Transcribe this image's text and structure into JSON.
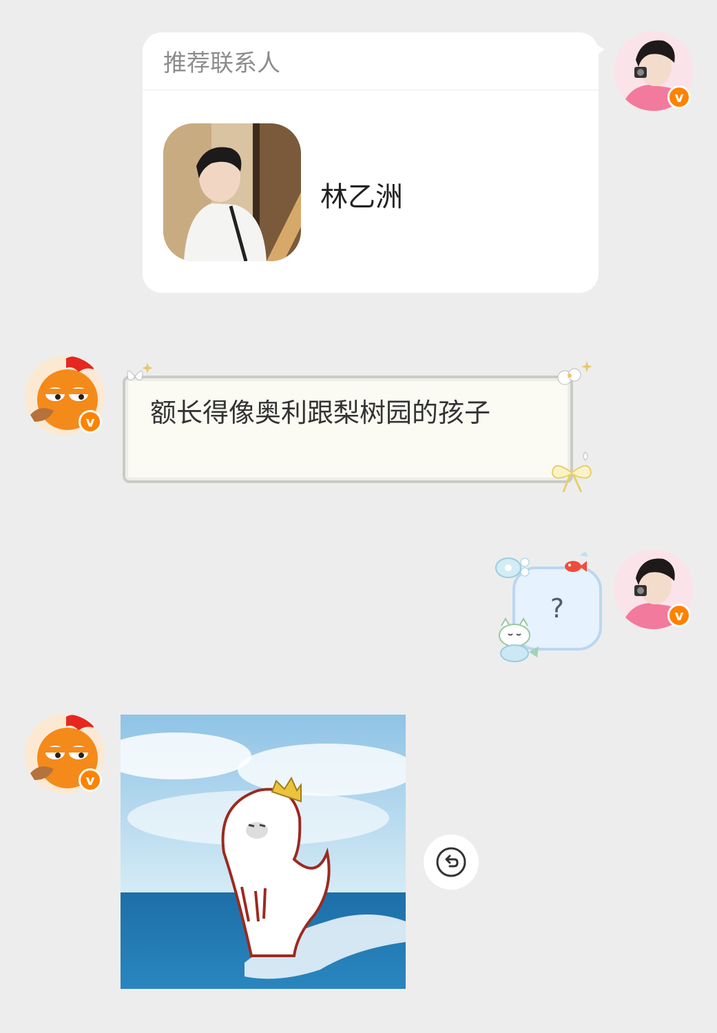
{
  "contact_card": {
    "header": "推荐联系人",
    "name": "林乙洲"
  },
  "messages": {
    "text_message": "额长得像奥利跟梨树园的孩子",
    "question_message": "?"
  },
  "badges": {
    "verified_symbol": "v"
  },
  "colors": {
    "background": "#ededed",
    "verified_badge": "#ff8200",
    "bubble_white": "#ffffff"
  }
}
